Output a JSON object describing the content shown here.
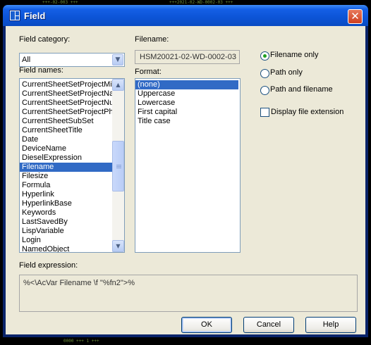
{
  "window": {
    "title": "Field",
    "close_glyph": "✕",
    "accent_color": "#0c54d6"
  },
  "field_category": {
    "label": "Field category:",
    "value": "All"
  },
  "field_names": {
    "label": "Field names:",
    "items": [
      "CurrentSheetSetProjectMil",
      "CurrentSheetSetProjectNa",
      "CurrentSheetSetProjectNu",
      "CurrentSheetSetProjectPh",
      "CurrentSheetSubSet",
      "CurrentSheetTitle",
      "Date",
      "DeviceName",
      "DieselExpression",
      "Filename",
      "Filesize",
      "Formula",
      "Hyperlink",
      "HyperlinkBase",
      "Keywords",
      "LastSavedBy",
      "LispVariable",
      "Login",
      "NamedObject"
    ],
    "selected": "Filename"
  },
  "filename": {
    "label": "Filename:",
    "value": "HSM20021-02-WD-0002-03"
  },
  "format": {
    "label": "Format:",
    "items": [
      "(none)",
      "Uppercase",
      "Lowercase",
      "First capital",
      "Title case"
    ],
    "selected": "(none)"
  },
  "options": {
    "radios": [
      {
        "label": "Filename only",
        "checked": true
      },
      {
        "label": "Path only",
        "checked": false
      },
      {
        "label": "Path and filename",
        "checked": false
      }
    ],
    "display_extension": {
      "label": "Display file extension",
      "checked": false
    }
  },
  "field_expression": {
    "label": "Field expression:",
    "value": "%<\\AcVar Filename \\f \"%fn2\">%"
  },
  "buttons": {
    "ok": "OK",
    "cancel": "Cancel",
    "help": "Help"
  },
  "icons": {
    "app": "field-app-icon",
    "close": "close-icon",
    "dropdown": "chevron-down-icon",
    "scroll_up": "arrow-up-icon",
    "scroll_down": "arrow-down-icon"
  }
}
